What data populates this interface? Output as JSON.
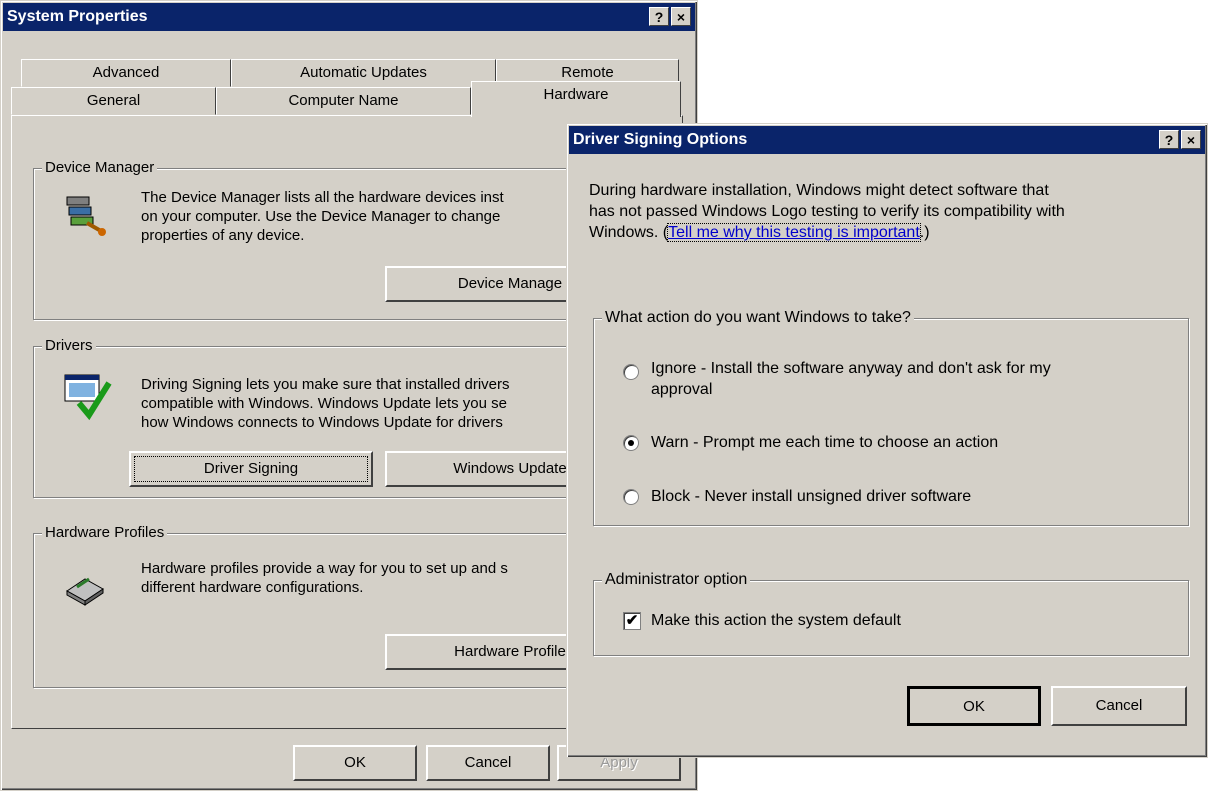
{
  "system_properties": {
    "title": "System Properties",
    "help_btn": "?",
    "close_btn": "×",
    "tabs_back": [
      "Advanced",
      "Automatic Updates",
      "Remote"
    ],
    "tabs_front": [
      "General",
      "Computer Name",
      "Hardware"
    ],
    "device_manager": {
      "legend": "Device Manager",
      "description": "The Device Manager lists all the hardware devices inst on your computer. Use the Device Manager to change properties of any device.",
      "line1": "The Device Manager lists all the hardware devices inst",
      "line2": "on your computer. Use the Device Manager to change",
      "line3": "properties of any device.",
      "button": "Device Manage"
    },
    "drivers": {
      "legend": "Drivers",
      "line1": "Driving Signing lets you make sure that installed drivers",
      "line2": "compatible with Windows. Windows Update lets you se",
      "line3": "how Windows connects to Windows Update for drivers",
      "driver_signing_button": "Driver Signing",
      "windows_update_button": "Windows Update"
    },
    "hardware_profiles": {
      "legend": "Hardware Profiles",
      "line1": "Hardware profiles provide a way for you to set up and s",
      "line2": "different hardware configurations.",
      "button": "Hardware Profile"
    },
    "ok": "OK",
    "cancel": "Cancel",
    "apply": "Apply"
  },
  "driver_signing_options": {
    "title": "Driver Signing Options",
    "help_btn": "?",
    "close_btn": "×",
    "intro_line1": "During hardware installation, Windows might detect software that",
    "intro_line2": "has not passed Windows Logo testing to verify its compatibility with",
    "intro_line3_prefix": "Windows. (",
    "intro_link": "Tell me why this testing is important",
    "intro_line3_suffix": ".)",
    "action_group": {
      "legend": "What action do you want Windows to take?",
      "options": [
        {
          "label_line1": "Ignore - Install the software anyway and don't ask for my",
          "label_line2": "approval",
          "checked": false
        },
        {
          "label_line1": "Warn - Prompt me each time to choose an action",
          "checked": true
        },
        {
          "label_line1": "Block - Never install unsigned driver software",
          "checked": false
        }
      ]
    },
    "admin_group": {
      "legend": "Administrator option",
      "checkbox_label": "Make this action the system default",
      "checkbox_mark": "✔",
      "checked": true
    },
    "ok": "OK",
    "cancel": "Cancel"
  },
  "icons": [
    "device-manager-icon",
    "drivers-icon",
    "hardware-profiles-icon"
  ]
}
